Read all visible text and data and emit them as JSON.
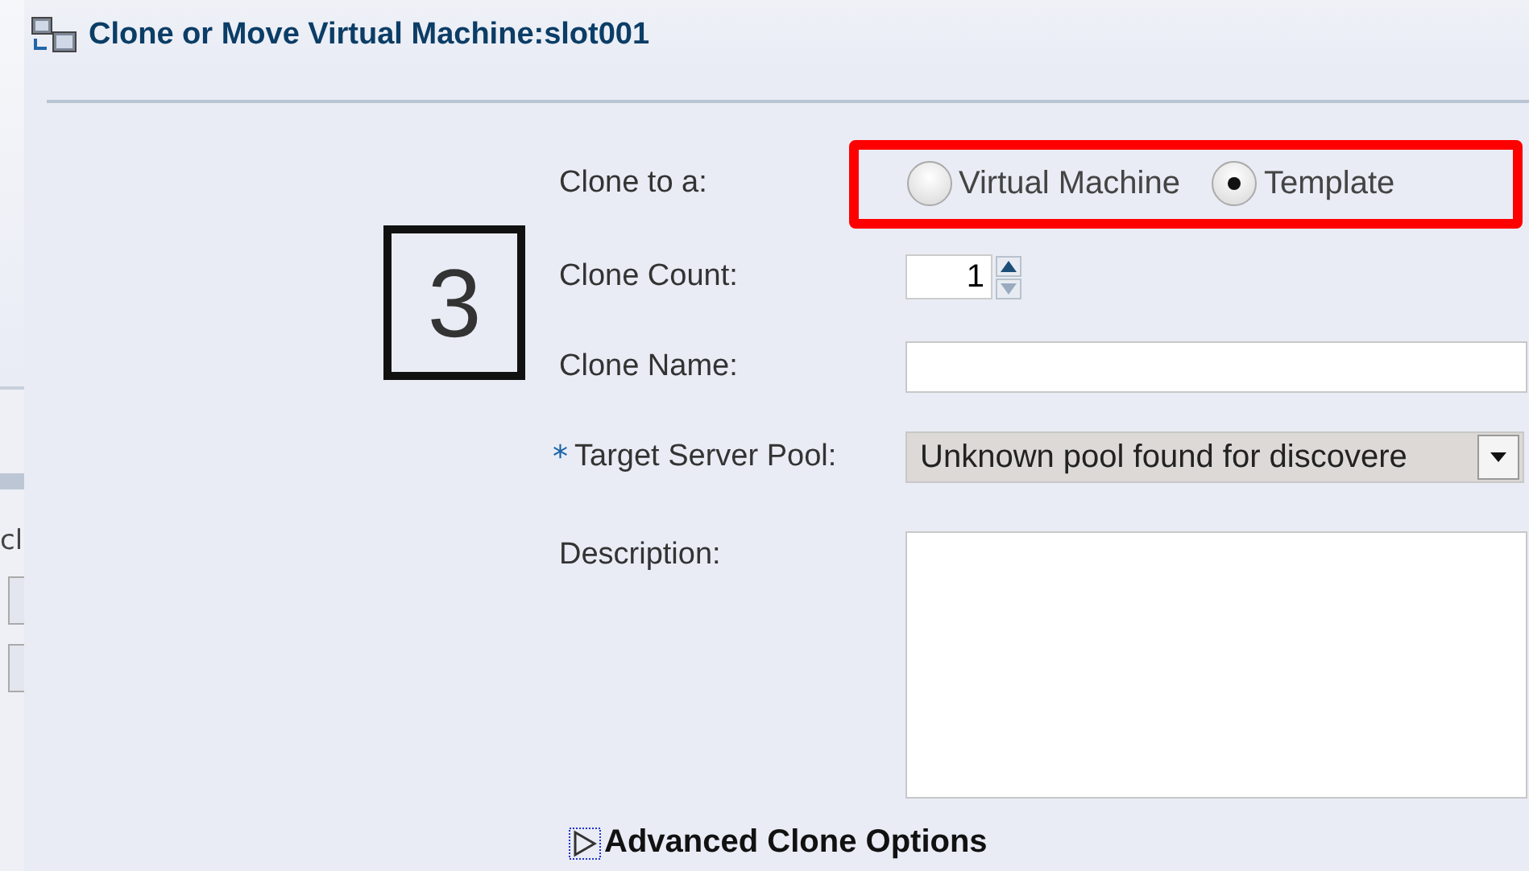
{
  "background_window": {
    "text": "cl"
  },
  "dialog": {
    "title": "Clone or Move Virtual Machine:slot001"
  },
  "form": {
    "clone_to": {
      "label": "Clone to a:",
      "options": [
        {
          "label": "Virtual Machine",
          "selected": false
        },
        {
          "label": "Template",
          "selected": true
        }
      ]
    },
    "clone_count": {
      "label": "Clone Count:",
      "value": "1"
    },
    "clone_name": {
      "label": "Clone Name:"
    },
    "target_server_pool": {
      "label": "Target Server Pool:",
      "required": true,
      "required_mark": "*",
      "value": "Unknown pool found for discovere"
    },
    "description": {
      "label": "Description:"
    },
    "advanced": {
      "label": "Advanced Clone Options",
      "expanded": false
    }
  },
  "annotation": {
    "text": "3"
  }
}
